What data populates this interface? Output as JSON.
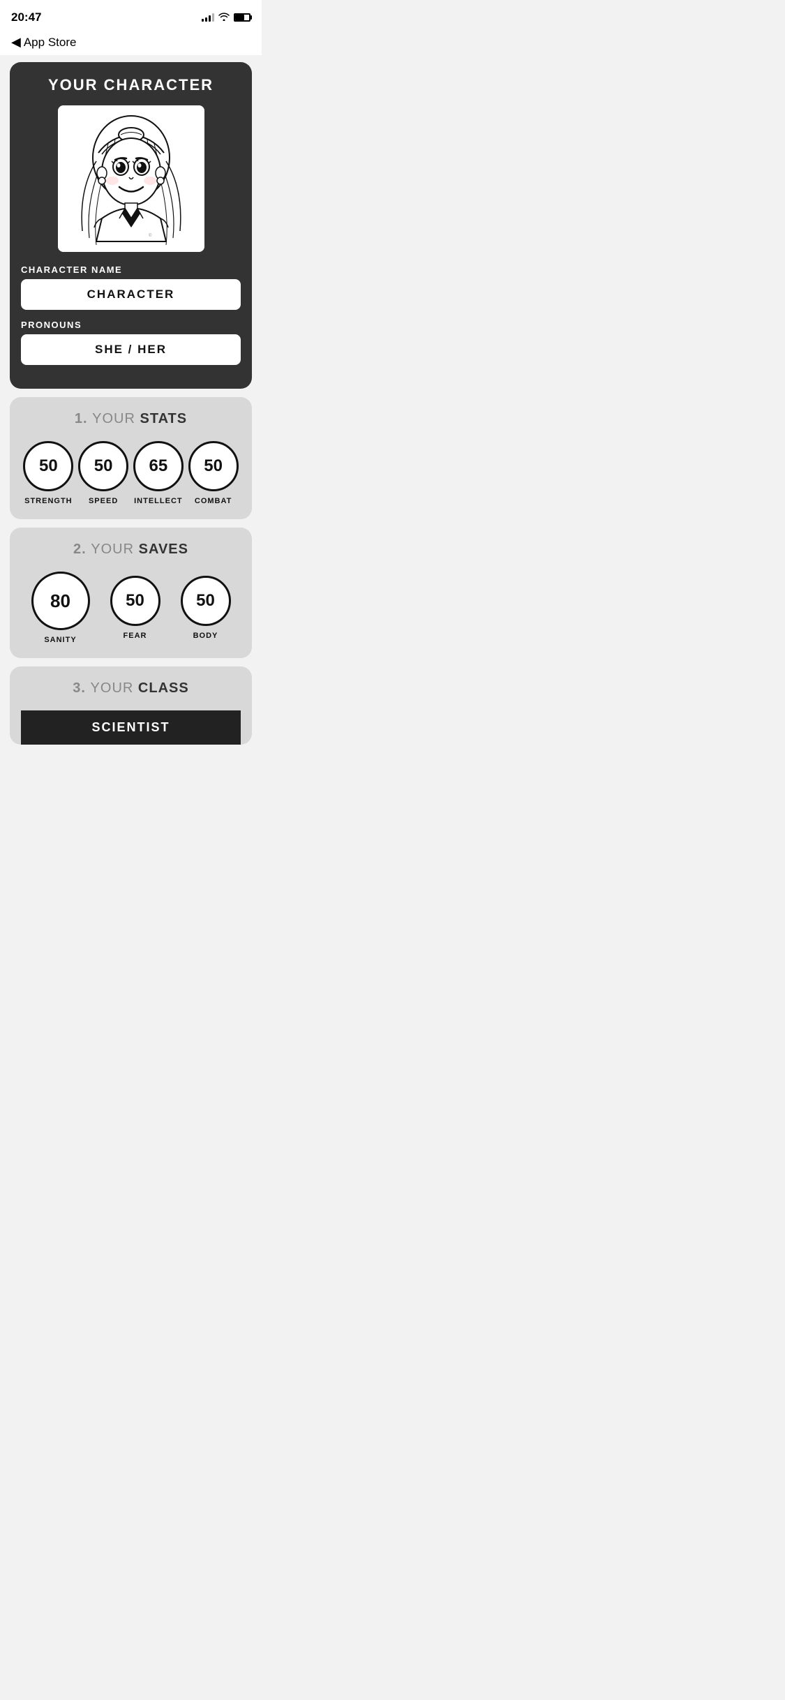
{
  "statusBar": {
    "time": "20:47",
    "back": "App Store"
  },
  "characterCard": {
    "title": "YOUR CHARACTER",
    "nameLabel": "CHARACTER NAME",
    "nameValue": "CHARACTER",
    "pronounsLabel": "PRONOUNS",
    "pronounsValue": "SHE / HER"
  },
  "statsSection": {
    "sectionNumber": "1.",
    "yourLabel": "YOUR",
    "titleLabel": "STATS",
    "stats": [
      {
        "value": "50",
        "label": "STRENGTH"
      },
      {
        "value": "50",
        "label": "SPEED"
      },
      {
        "value": "65",
        "label": "INTELLECT"
      },
      {
        "value": "50",
        "label": "COMBAT"
      }
    ]
  },
  "savesSection": {
    "sectionNumber": "2.",
    "yourLabel": "YOUR",
    "titleLabel": "SAVES",
    "saves": [
      {
        "value": "80",
        "label": "SANITY"
      },
      {
        "value": "50",
        "label": "FEAR"
      },
      {
        "value": "50",
        "label": "BODY"
      }
    ]
  },
  "classSection": {
    "sectionNumber": "3.",
    "yourLabel": "YOUR",
    "titleLabel": "CLASS",
    "classValue": "SCIENTIST"
  }
}
